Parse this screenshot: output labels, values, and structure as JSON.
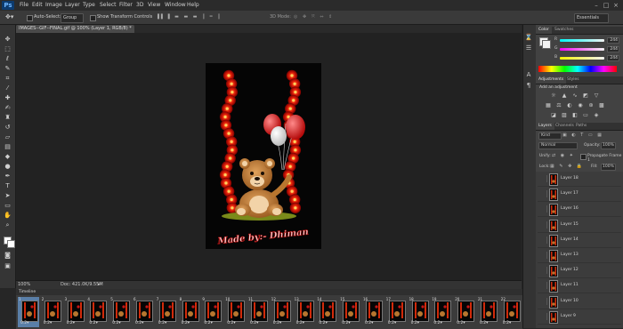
{
  "menubar": {
    "logo": "Ps",
    "items": [
      "File",
      "Edit",
      "Image",
      "Layer",
      "Type",
      "Select",
      "Filter",
      "3D",
      "View",
      "Window",
      "Help"
    ]
  },
  "options": {
    "auto_select_label": "Auto-Select:",
    "auto_select_value": "Group",
    "show_transform_label": "Show Transform Controls",
    "mode_3d_label": "3D Mode:",
    "workspace": "Essentials"
  },
  "document": {
    "tab_title": "IMAGES--GIF--FINAL.gif @ 100% (Layer 1, RGB/8) *",
    "zoom": "100%",
    "doc_info": "Doc: 421.0K/9.55M",
    "caption": "Made by:- Dhiman"
  },
  "color_panel": {
    "tabs": [
      "Color",
      "Swatches"
    ],
    "channels": [
      {
        "label": "R",
        "value": "244"
      },
      {
        "label": "G",
        "value": "244"
      },
      {
        "label": "B",
        "value": "244"
      }
    ]
  },
  "adjustments_panel": {
    "tabs": [
      "Adjustments",
      "Styles"
    ],
    "hint": "Add an adjustment"
  },
  "layers_panel": {
    "tabs": [
      "Layers",
      "Channels",
      "Paths"
    ],
    "kind": "Kind",
    "blend_mode": "Normal",
    "opacity_label": "Opacity:",
    "opacity_value": "100%",
    "unify_label": "Unify:",
    "propagate_label": "Propagate Frame 1",
    "lock_label": "Lock:",
    "fill_label": "Fill:",
    "fill_value": "100%",
    "layers": [
      "Layer 18",
      "Layer 17",
      "Layer 16",
      "Layer 15",
      "Layer 14",
      "Layer 13",
      "Layer 12",
      "Layer 11",
      "Layer 10",
      "Layer 9"
    ]
  },
  "timeline": {
    "title": "Timeline",
    "frames": [
      {
        "num": "1",
        "delay": "0.2"
      },
      {
        "num": "2",
        "delay": "0.2"
      },
      {
        "num": "3",
        "delay": "0.2"
      },
      {
        "num": "4",
        "delay": "0.2"
      },
      {
        "num": "5",
        "delay": "0.2"
      },
      {
        "num": "6",
        "delay": "0.2"
      },
      {
        "num": "7",
        "delay": "0.2"
      },
      {
        "num": "8",
        "delay": "0.2"
      },
      {
        "num": "9",
        "delay": "0.2"
      },
      {
        "num": "10",
        "delay": "0.2"
      },
      {
        "num": "11",
        "delay": "0.2"
      },
      {
        "num": "12",
        "delay": "0.2"
      },
      {
        "num": "13",
        "delay": "0.2"
      },
      {
        "num": "14",
        "delay": "0.2"
      },
      {
        "num": "15",
        "delay": "0.2"
      },
      {
        "num": "16",
        "delay": "0.2"
      },
      {
        "num": "17",
        "delay": "0.2"
      },
      {
        "num": "18",
        "delay": "0.2"
      },
      {
        "num": "19",
        "delay": "0.2"
      },
      {
        "num": "20",
        "delay": "0.2"
      },
      {
        "num": "21",
        "delay": "0.2"
      },
      {
        "num": "22",
        "delay": "0.2"
      }
    ]
  },
  "colors": {
    "app_bg": "#262626",
    "panel_bg": "#424242",
    "accent": "#2d6fb6",
    "artboard": "#050505"
  }
}
